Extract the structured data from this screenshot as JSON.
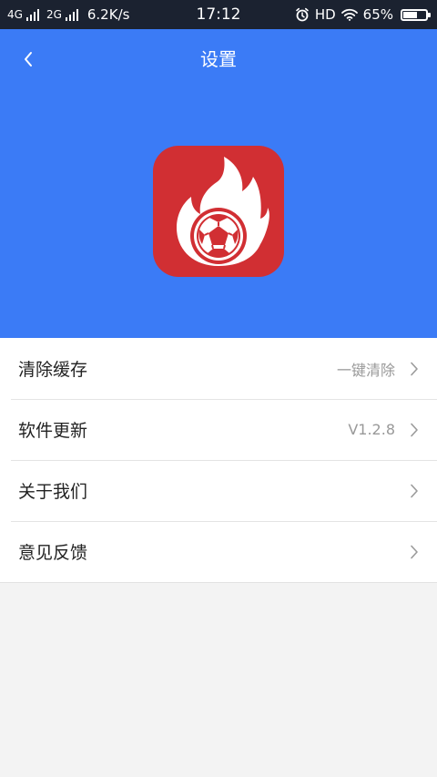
{
  "status_bar": {
    "network_1": "4G",
    "network_2": "2G",
    "speed": "6.2K/s",
    "time": "17:12",
    "hd": "HD",
    "battery": "65%",
    "battery_level": 0.65
  },
  "header": {
    "title": "设置",
    "background_color": "#3b7bf6",
    "logo_icon": "flaming-soccer-ball-logo"
  },
  "settings": {
    "items": [
      {
        "label": "清除缓存",
        "value": "一键清除"
      },
      {
        "label": "软件更新",
        "value": "V1.2.8"
      },
      {
        "label": "关于我们",
        "value": ""
      },
      {
        "label": "意见反馈",
        "value": ""
      }
    ]
  }
}
